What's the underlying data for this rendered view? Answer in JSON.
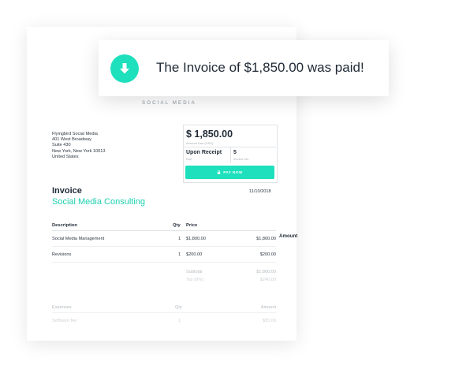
{
  "toast": {
    "message": "The Invoice of $1,850.00 was paid!",
    "icon": "download-arrow-icon",
    "accent_color": "#1ee0bd"
  },
  "brand": {
    "subtitle": "SOCIAL MEDIA"
  },
  "address": {
    "lines": [
      "Flyingbird Social Media",
      "401 West Broadway",
      "Suite 430",
      "New York, New York 10013",
      "United States"
    ]
  },
  "payment": {
    "amount": "$ 1,850.00",
    "amount_label": "Amount Due (USD)",
    "terms": "Upon Receipt",
    "terms_label": "Due",
    "count": "5",
    "count_label": "Invoice No.",
    "button_label": "PAY NOW"
  },
  "invoice": {
    "title": "Invoice",
    "subtitle": "Social Media Consulting",
    "date": "11/10/2018"
  },
  "items_table": {
    "headers": {
      "description": "Description",
      "qty": "Qty",
      "price": "Price",
      "amount": "Amount"
    },
    "rows": [
      {
        "description": "Social Media Management",
        "qty": "1",
        "price": "$1,800.00",
        "amount": "$1,800.00"
      },
      {
        "description": "Revisions",
        "qty": "1",
        "price": "$200.00",
        "amount": "$200.00"
      }
    ],
    "subtotal_label": "Subtotal",
    "subtotal_value": "$1,800.00",
    "tax_label": "Tax (8%)",
    "tax_value": "$240.00"
  },
  "expenses_table": {
    "headers": {
      "expenses": "Expenses",
      "qty": "Qty",
      "amount": "Amount"
    },
    "rows": [
      {
        "description": "Software fee",
        "qty": "1",
        "amount": "$55.00"
      }
    ]
  }
}
